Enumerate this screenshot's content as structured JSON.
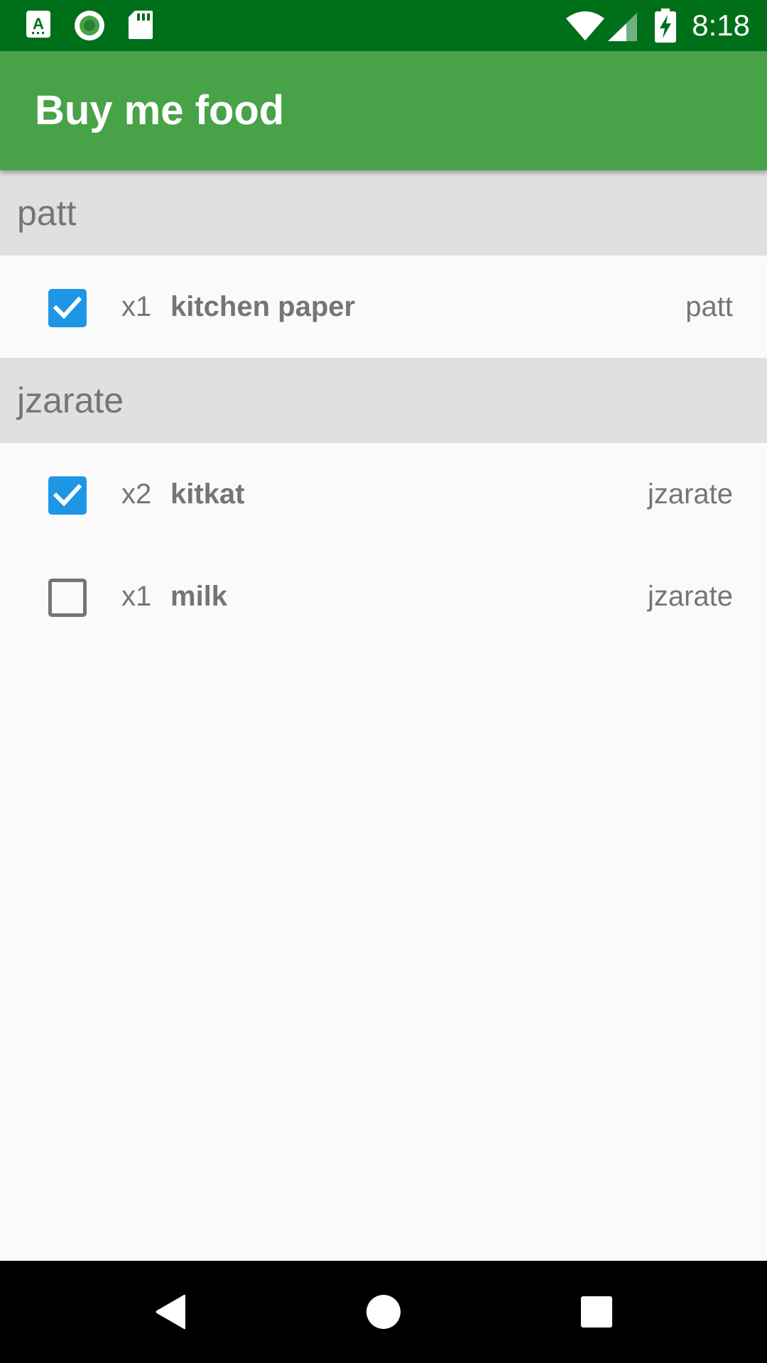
{
  "status_bar": {
    "time": "8:18",
    "icons": [
      "keyboard-a-icon",
      "record-icon",
      "sd-card-icon",
      "wifi-icon",
      "cell-signal-icon",
      "battery-charging-icon"
    ]
  },
  "app_bar": {
    "title": "Buy me food",
    "color": "#47A248",
    "status_color": "#006F1A"
  },
  "groups": [
    {
      "owner": "patt",
      "items": [
        {
          "checked": true,
          "qty": "x1",
          "name": "kitchen paper",
          "assignee": "patt"
        }
      ]
    },
    {
      "owner": "jzarate",
      "items": [
        {
          "checked": true,
          "qty": "x2",
          "name": "kitkat",
          "assignee": "jzarate"
        },
        {
          "checked": false,
          "qty": "x1",
          "name": "milk",
          "assignee": "jzarate"
        }
      ]
    }
  ],
  "colors": {
    "checkbox_checked": "#1E96E6",
    "text_secondary": "#757575",
    "header_bg": "#E0E0E0"
  },
  "nav_bar": {
    "icons": [
      "back-icon",
      "home-icon",
      "recents-icon"
    ]
  }
}
